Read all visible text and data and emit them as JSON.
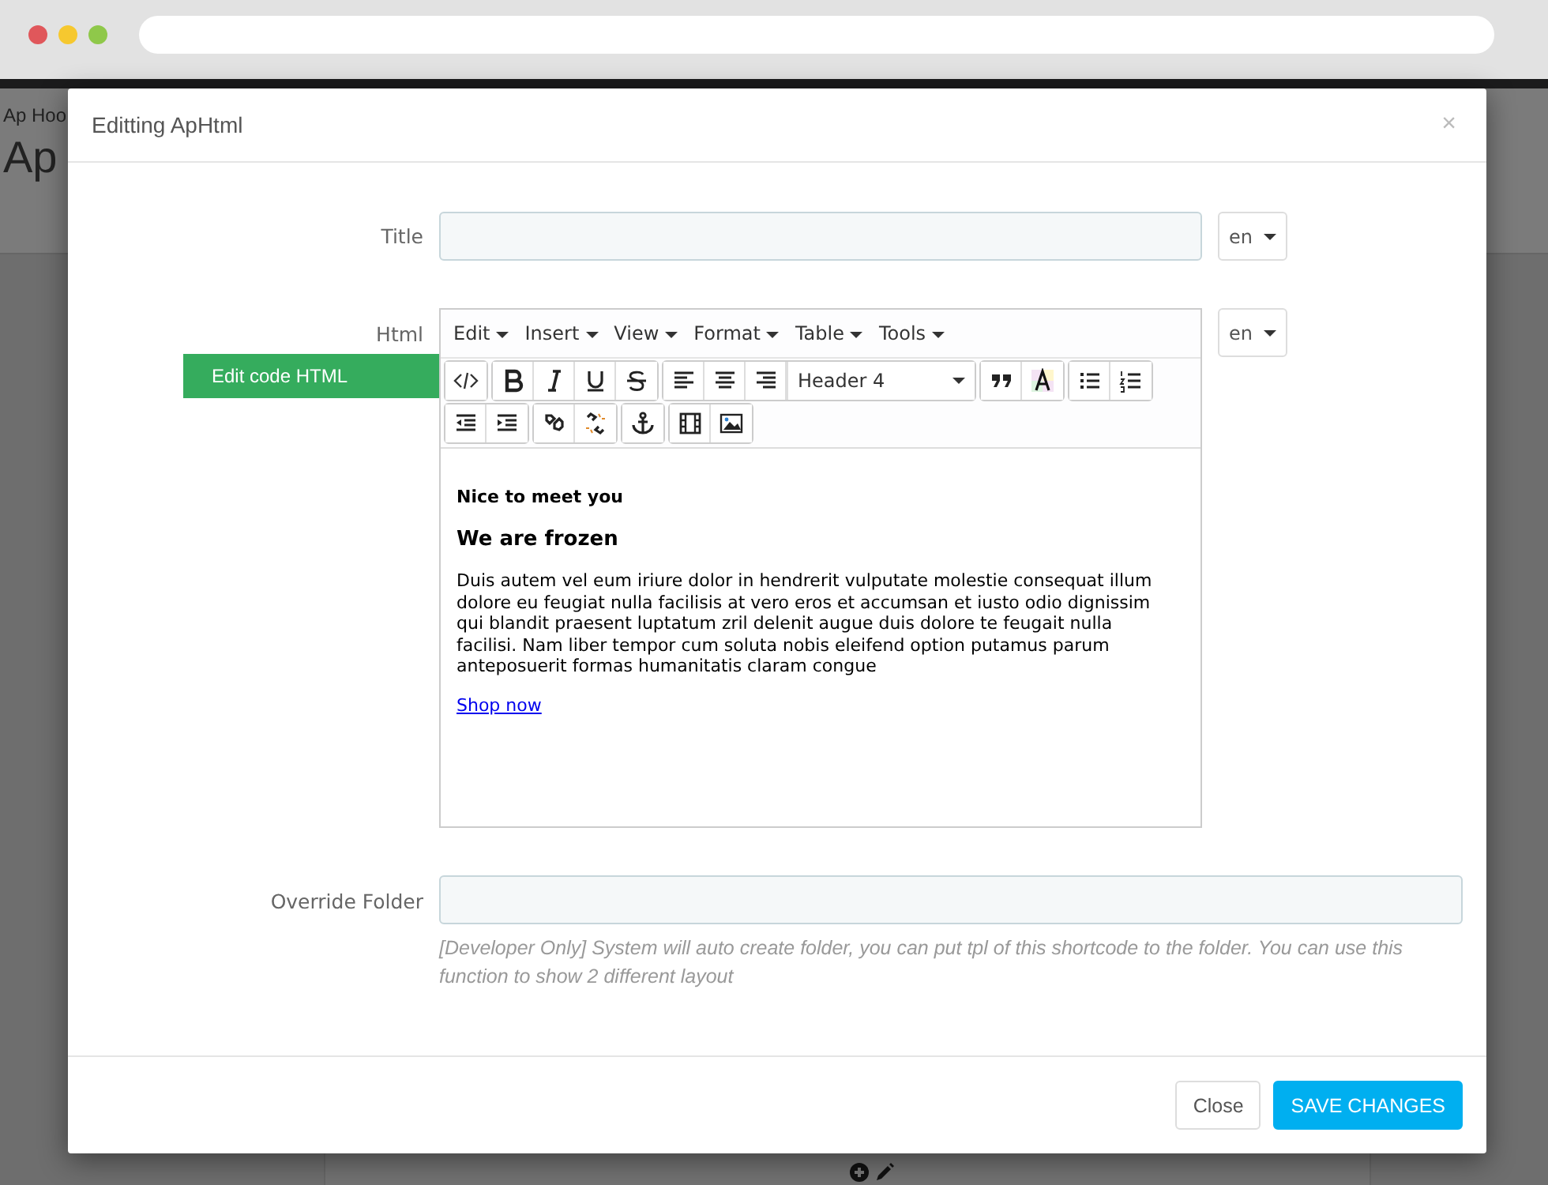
{
  "browser": {
    "dots": [
      {
        "color": "#e0575b"
      },
      {
        "color": "#f6c82f"
      },
      {
        "color": "#8fc84a"
      }
    ]
  },
  "background_page": {
    "breadcrumb": "Ap Hoo",
    "heading": "Ap"
  },
  "modal": {
    "title": "Editting ApHtml",
    "close": "×",
    "title_field": {
      "label": "Title",
      "language": "en"
    },
    "html_field": {
      "label": "Html",
      "language": "en",
      "edit_code_button": "Edit code HTML",
      "menus": [
        "Edit",
        "Insert",
        "View",
        "Format",
        "Table",
        "Tools"
      ],
      "block_format": "Header 4",
      "content": {
        "subheading": "Nice to meet you",
        "heading": "We are frozen",
        "paragraph": "Duis autem vel eum iriure dolor in hendrerit vulputate molestie consequat illum dolore eu feugiat nulla facilisis at vero eros et accumsan et iusto odio dignissim qui blandit praesent luptatum zril delenit augue duis dolore te feugait nulla facilisi. Nam liber tempor cum soluta nobis eleifend option putamus parum anteposuerit formas humanitatis claram congue",
        "link": "Shop now"
      }
    },
    "override_folder": {
      "label": "Override Folder",
      "help": "[Developer Only] System will auto create folder, you can put tpl of this shortcode to the folder. You can use this function to show 2 different layout"
    },
    "buttons": [
      {
        "label": "Close",
        "kind": "default"
      },
      {
        "label": "SAVE CHANGES",
        "kind": "primary"
      }
    ]
  }
}
